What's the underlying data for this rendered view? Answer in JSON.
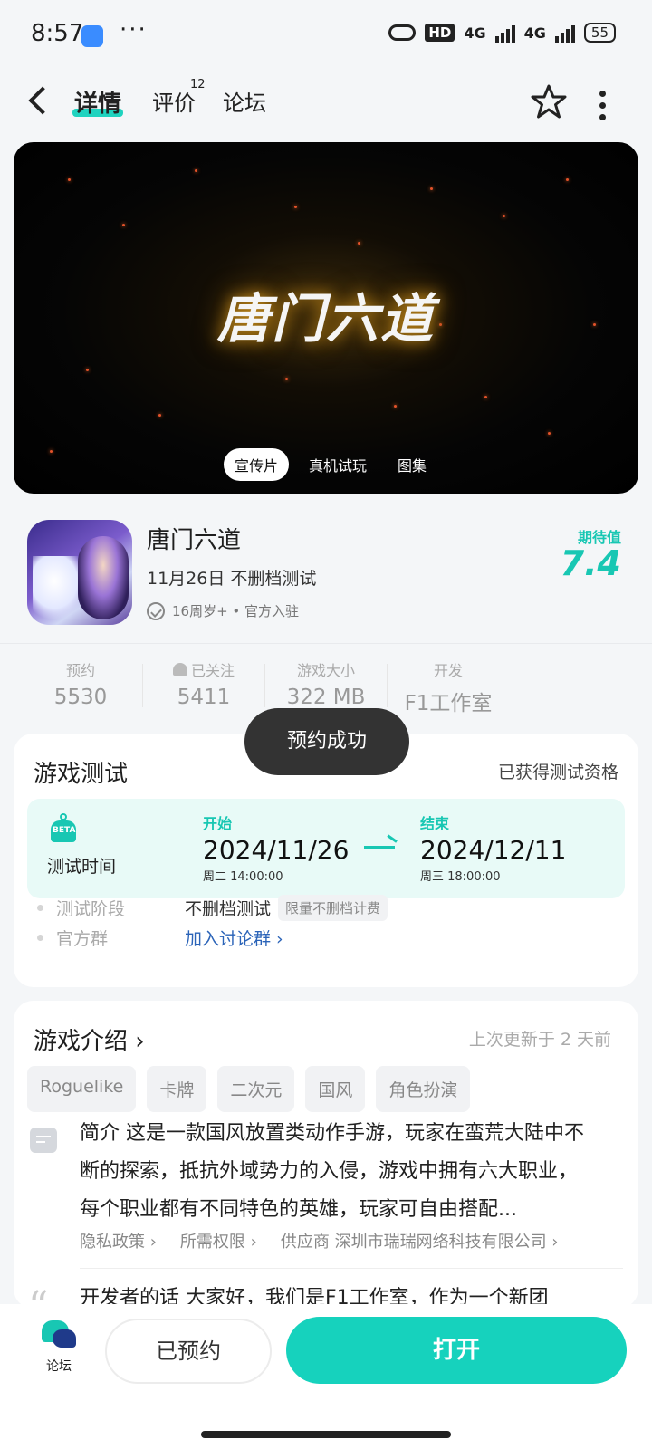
{
  "status_bar": {
    "time": "8:57",
    "dots": "···",
    "hd": "HD",
    "net1": "4G",
    "net2": "4G",
    "battery": "55"
  },
  "header": {
    "tabs": [
      {
        "label": "详情"
      },
      {
        "label": "评价",
        "badge": "12"
      },
      {
        "label": "论坛"
      }
    ]
  },
  "banner": {
    "title": "唐门六道",
    "media_tabs": [
      "宣传片",
      "真机试玩",
      "图集"
    ]
  },
  "app": {
    "name": "唐门六道",
    "subtitle": "11月26日 不删档测试",
    "meta": "16周岁+ • 官方入驻",
    "anticipation_label": "期待值",
    "anticipation_value": "7.4"
  },
  "stats": [
    {
      "label": "预约",
      "value": "5530"
    },
    {
      "label": "已关注",
      "value": "5411"
    },
    {
      "label": "游戏大小",
      "value": "322 MB"
    },
    {
      "label": "开发",
      "value": "F1工作室"
    }
  ],
  "toast": "预约成功",
  "test_card": {
    "title": "游戏测试",
    "qualification": "已获得测试资格",
    "beta": "BETA",
    "time_label": "测试时间",
    "start": {
      "label": "开始",
      "date": "2024/11/26",
      "time": "周二  14:00:00"
    },
    "end": {
      "label": "结束",
      "date": "2024/12/11",
      "time": "周三  18:00:00"
    },
    "stage_label": "测试阶段",
    "stage_value": "不删档测试",
    "stage_tag": "限量不删档计费",
    "group_label": "官方群",
    "group_link": "加入讨论群 ›"
  },
  "intro_card": {
    "title": "游戏介绍 ›",
    "updated": "上次更新于 2 天前",
    "tags": [
      "Roguelike",
      "卡牌",
      "二次元",
      "国风",
      "角色扮演"
    ],
    "text": "简介 这是一款国风放置类动作手游，玩家在蛮荒大陆中不断的探索，抵抗外域势力的入侵，游戏中拥有六大职业，每个职业都有不同特色的英雄，玩家可自由搭配...",
    "links": [
      "隐私政策 ›",
      "所需权限 ›",
      "供应商 深圳市瑞瑞网络科技有限公司 ›"
    ],
    "dev_text": "开发者的话 大家好，我们是F1工作室，作为一个新团"
  },
  "bottom_bar": {
    "forum_label": "论坛",
    "reserved_label": "已预约",
    "open_label": "打开"
  },
  "colors": {
    "accent": "#16d2bd",
    "link": "#2a63b8"
  }
}
